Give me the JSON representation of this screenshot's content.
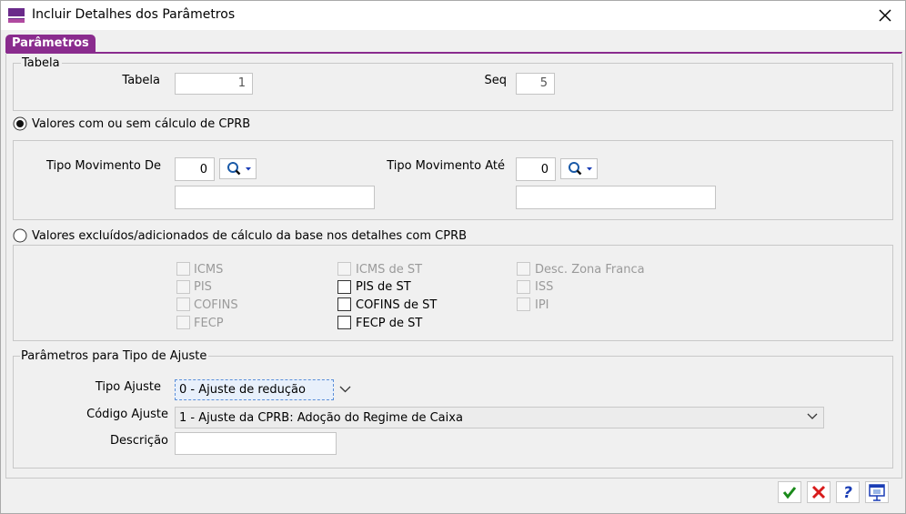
{
  "window": {
    "title": "Incluir Detalhes dos Parâmetros"
  },
  "tab": {
    "label": "Parâmetros"
  },
  "tabela_group": {
    "legend": "Tabela",
    "tabela_label": "Tabela",
    "tabela_value": "1",
    "seq_label": "Seq",
    "seq_value": "5"
  },
  "radio_cprb": {
    "label": "Valores com ou sem cálculo de CPRB",
    "checked": true
  },
  "movimento_group": {
    "de_label": "Tipo Movimento De",
    "de_value": "0",
    "de_desc": "",
    "ate_label": "Tipo Movimento Até",
    "ate_value": "0",
    "ate_desc": ""
  },
  "radio_excluidos": {
    "label": "Valores excluídos/adicionados de cálculo da base nos detalhes com CPRB",
    "checked": false
  },
  "checkboxes": {
    "icms": "ICMS",
    "pis": "PIS",
    "cofins": "COFINS",
    "fecp": "FECP",
    "icms_st": "ICMS de ST",
    "pis_st": "PIS de ST",
    "cofins_st": "COFINS de ST",
    "fecp_st": "FECP de ST",
    "desc_zona_franca": "Desc. Zona Franca",
    "iss": "ISS",
    "ipi": "IPI"
  },
  "ajuste_group": {
    "legend": "Parâmetros para Tipo de Ajuste",
    "tipo_label": "Tipo Ajuste",
    "tipo_value": "0 - Ajuste de redução",
    "codigo_label": "Código Ajuste",
    "codigo_value": "1 - Ajuste da CPRB: Adoção do Regime de Caixa",
    "descricao_label": "Descrição",
    "descricao_value": ""
  },
  "colors": {
    "accent": "#8a2c8e",
    "ok": "#1a8a1a",
    "cancel": "#d81b1b",
    "help": "#1a3db5"
  }
}
